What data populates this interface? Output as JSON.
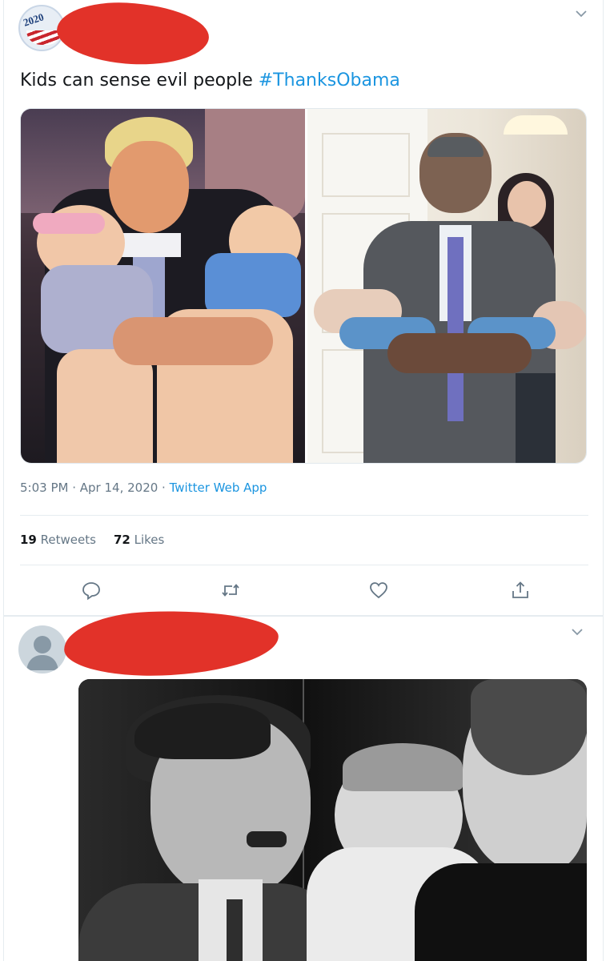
{
  "tweet1": {
    "avatar_badge": "2020",
    "text_plain": "Kids can sense evil people ",
    "hashtag": "#ThanksObama",
    "time": "5:03 PM",
    "date": "Apr 14, 2020",
    "separator": " · ",
    "source": "Twitter Web App",
    "retweets_count": "19",
    "retweets_label": "Retweets",
    "likes_count": "72",
    "likes_label": "Likes",
    "photos": [
      {
        "icon": "photo-trump-babies"
      },
      {
        "icon": "photo-obama-babies"
      }
    ],
    "actions": [
      {
        "name": "reply",
        "icon": "reply-icon"
      },
      {
        "name": "retweet",
        "icon": "retweet-icon"
      },
      {
        "name": "like",
        "icon": "heart-icon"
      },
      {
        "name": "share",
        "icon": "share-icon"
      }
    ]
  },
  "tweet2": {
    "avatar": "default-avatar-icon",
    "photo": {
      "icon": "photo-black-white-baby"
    }
  },
  "colors": {
    "link": "#1b95e0",
    "text": "#14171a",
    "muted": "#657786",
    "redaction": "#e23229",
    "divider": "#e6ecf0"
  }
}
